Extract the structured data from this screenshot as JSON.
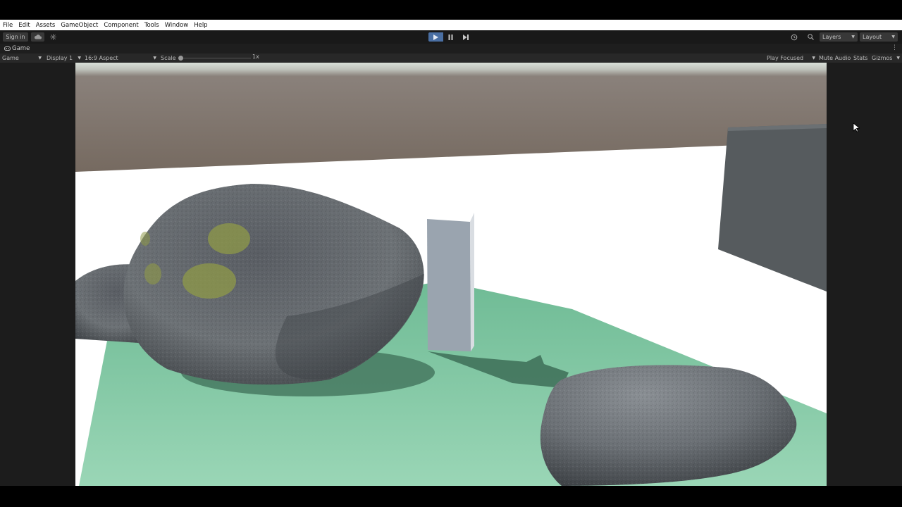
{
  "menu": {
    "items": [
      "File",
      "Edit",
      "Assets",
      "GameObject",
      "Component",
      "Tools",
      "Window",
      "Help"
    ]
  },
  "toolbar": {
    "sign_in_label": "Sign in",
    "layers_label": "Layers",
    "layout_label": "Layout",
    "play_state": "playing",
    "accent_color": "#4a6fa3"
  },
  "tab": {
    "title": "Game",
    "icon": "gamepad-icon"
  },
  "game_view_bar": {
    "view_mode": "Game",
    "display": "Display 1",
    "aspect": "16:9 Aspect",
    "scale_label": "Scale",
    "scale_value": "1x",
    "play_focused": "Play Focused",
    "mute_audio": "Mute Audio",
    "stats": "Stats",
    "gizmos": "Gizmos"
  },
  "scene": {
    "sky_color": "#d6dcd6",
    "horizon_color": "#7b716c",
    "ground_color": "#ffffff",
    "plane_color": "#86c9a5",
    "rock_color": "#676b6f",
    "pillar_color": "#9aa4af",
    "cube_color": "#565b5e"
  }
}
